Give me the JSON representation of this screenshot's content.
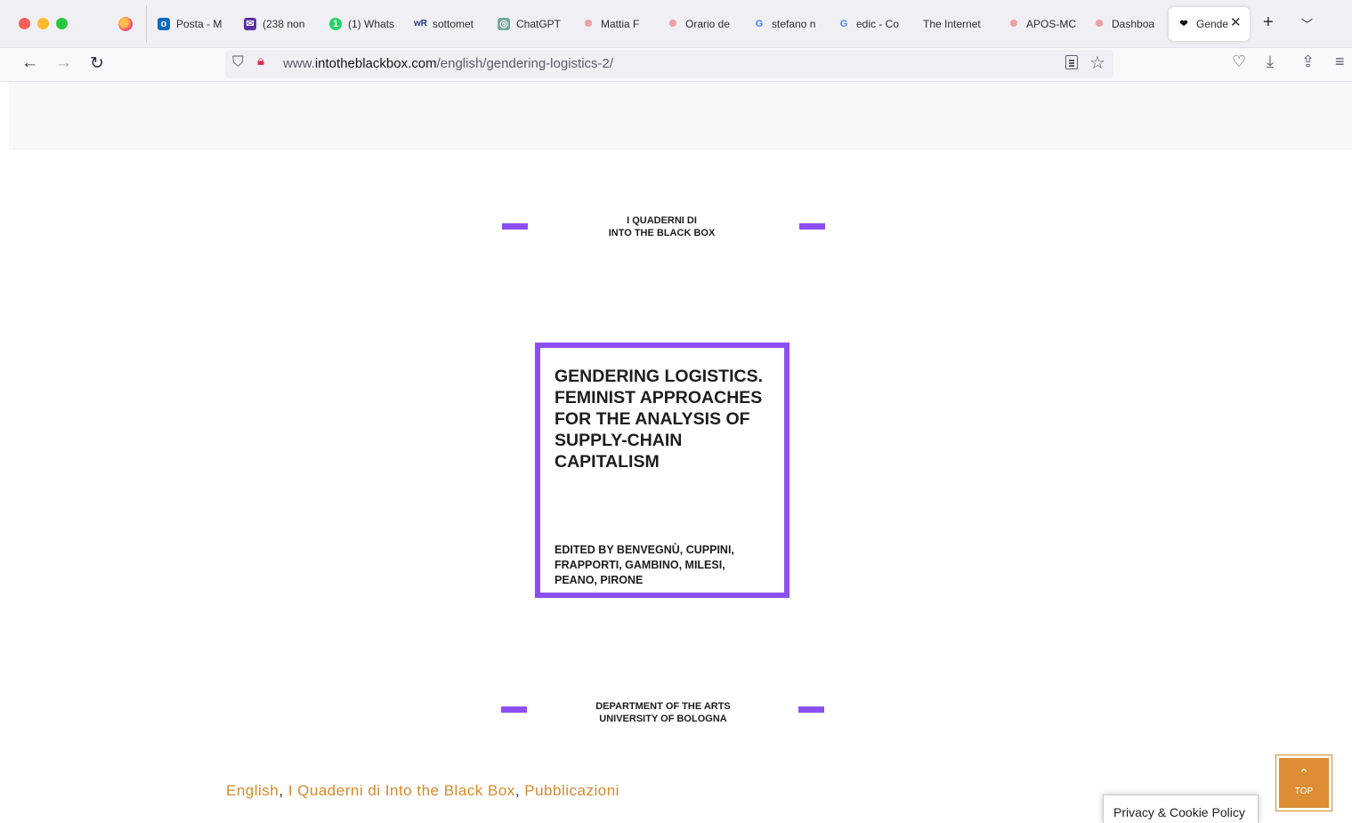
{
  "browser": {
    "tabs": [
      {
        "label": "Posta - M",
        "icon": "outlook-icon",
        "color": "#0f6cbd"
      },
      {
        "label": "(238 non",
        "icon": "mail-icon",
        "color": "#5b2ea6"
      },
      {
        "label": "(1) Whats",
        "icon": "whatsapp-icon",
        "color": "#25d366"
      },
      {
        "label": "sottomet",
        "icon": "wr-icon",
        "color": "#1e3a8a"
      },
      {
        "label": "ChatGPT",
        "icon": "chatgpt-icon",
        "color": "#74aa9c"
      },
      {
        "label": "Mattia F",
        "icon": "unibo-icon",
        "color": "#e8a0a0"
      },
      {
        "label": "Orario de",
        "icon": "unibo-icon",
        "color": "#e8a0a0"
      },
      {
        "label": "stefano n",
        "icon": "google-icon",
        "color": "#4285f4"
      },
      {
        "label": "edic - Co",
        "icon": "google-icon",
        "color": "#4285f4"
      },
      {
        "label": "The Internet",
        "icon": "",
        "color": ""
      },
      {
        "label": "APOS-MC",
        "icon": "unibo-icon",
        "color": "#e8a0a0"
      },
      {
        "label": "Dashboa",
        "icon": "unibo-icon",
        "color": "#e8a0a0"
      }
    ],
    "active_tab": {
      "label": "Gende",
      "icon": "blackbox-icon"
    },
    "url": {
      "prefix": "www.",
      "host": "intotheblackbox.com",
      "path": "/english/gendering-logistics-2/"
    }
  },
  "cover": {
    "top_line1": "I QUADERNI DI",
    "top_line2": "INTO THE BLACK BOX",
    "title_lines": [
      "GENDERING LOGISTICS.",
      "FEMINIST APPROACHES",
      "FOR THE ANALYSIS OF",
      "SUPPLY-CHAIN",
      "CAPITALISM"
    ],
    "editor_lines": [
      "EDITED BY BENVEGNÙ, CUPPINI,",
      "FRAPPORTI, GAMBINO, MILESI,",
      "PEANO, PIRONE"
    ],
    "bottom_line1": "DEPARTMENT OF THE ARTS",
    "bottom_line2": "UNIVERSITY OF BOLOGNA",
    "accent_color": "#8b4ff1"
  },
  "categories": {
    "items": [
      "English",
      "I Quaderni di Into the Black Box",
      "Pubblicazioni"
    ],
    "separator": ", ",
    "link_color": "#d8892a"
  },
  "top_button": {
    "label": "TOP"
  },
  "privacy": {
    "label": "Privacy & Cookie Policy"
  }
}
